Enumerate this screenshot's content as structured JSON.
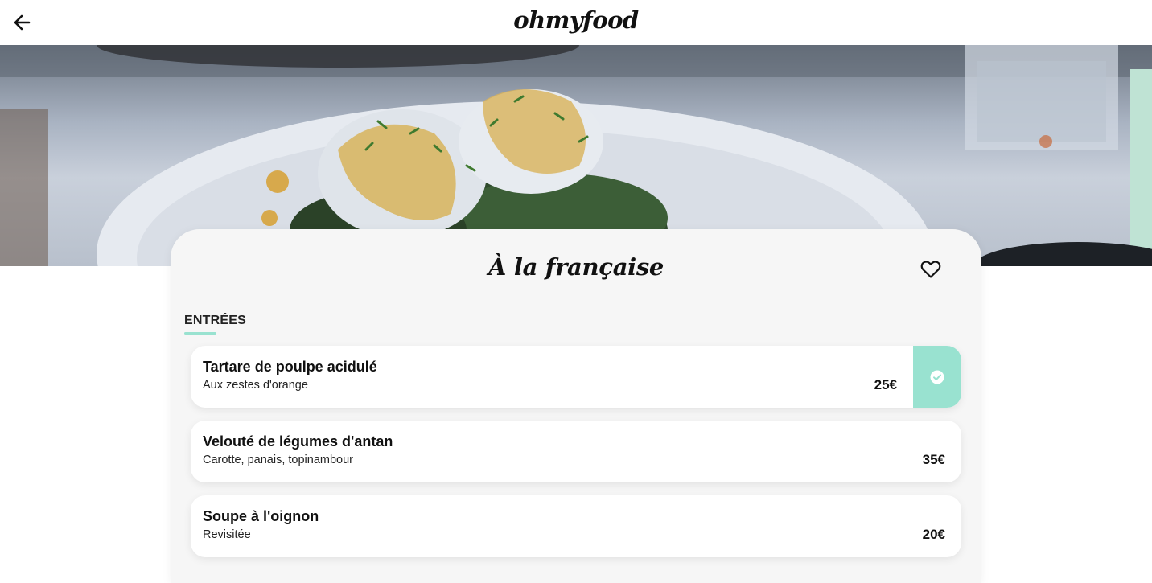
{
  "app": {
    "logo": "ohmyfood",
    "back_icon": "arrow-left-icon"
  },
  "restaurant": {
    "menu_title": "À la française",
    "favorite_icon": "heart-icon"
  },
  "sections": [
    {
      "title": "ENTRÉES",
      "dishes": [
        {
          "name": "Tartare de poulpe acidulé",
          "description": "Aux zestes d'orange",
          "price": "25€",
          "selected": true
        },
        {
          "name": "Velouté de légumes d'antan",
          "description": "Carotte, panais, topinambour",
          "price": "35€",
          "selected": false
        },
        {
          "name": "Soupe à l'oignon",
          "description": "Revisitée",
          "price": "20€",
          "selected": false
        }
      ]
    }
  ],
  "colors": {
    "accent": "#99e2d0",
    "card_bg": "#f6f6f6",
    "text": "#111111"
  }
}
